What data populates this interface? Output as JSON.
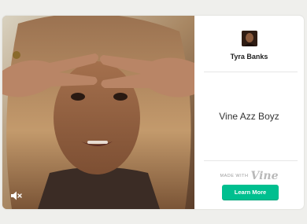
{
  "post": {
    "author_name": "Tyra Banks",
    "caption": "Vine Azz Boyz",
    "made_with_label": "MADE WITH",
    "brand_logo_text": "Vine",
    "learn_more_label": "Learn More"
  },
  "video": {
    "mute_icon": "speaker-muted-icon"
  },
  "colors": {
    "accent": "#00bf8f",
    "brand_gray": "#b9b9b9",
    "page_background": "#efefec"
  }
}
